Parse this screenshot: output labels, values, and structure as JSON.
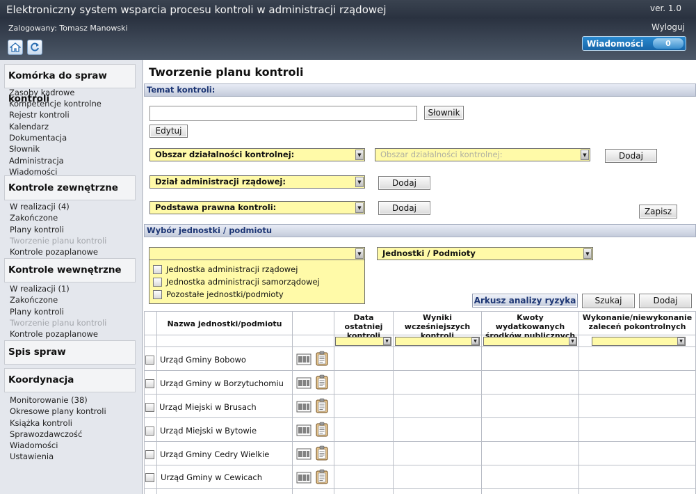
{
  "header": {
    "title": "Elektroniczny system wsparcia procesu kontroli w administracji rządowej",
    "version": "ver. 1.0",
    "user": "Zalogowany: Tomasz Manowski",
    "logout": "Wyloguj",
    "messages_label": "Wiadomości",
    "messages_count": "0"
  },
  "sidebar": {
    "sections": [
      {
        "title": "Komórka do spraw kontroli",
        "items": [
          "Zasoby kadrowe",
          "Kompetencje kontrolne",
          "Rejestr kontroli",
          "Kalendarz",
          "Dokumentacja",
          "Słownik",
          "Administracja",
          "Wiadomości"
        ]
      },
      {
        "title": "Kontrole zewnętrzne",
        "items": [
          "W realizacji (4)",
          "Zakończone",
          "Plany kontroli",
          "Tworzenie planu kontroli",
          "Kontrole pozaplanowe"
        ]
      },
      {
        "title": "Kontrole wewnętrzne",
        "items": [
          "W realizacji (1)",
          "Zakończone",
          "Plany kontroli",
          "Tworzenie planu kontroli",
          "Kontrole pozaplanowe"
        ]
      },
      {
        "title": "Spis spraw",
        "items": []
      },
      {
        "title": "Koordynacja",
        "items": [
          "Monitorowanie (38)",
          "Okresowe plany kontroli",
          "Książka kontroli",
          "Sprawozdawczość",
          "Wiadomości",
          "Ustawienia"
        ]
      }
    ]
  },
  "main": {
    "title": "Tworzenie planu kontroli",
    "section_topic": "Temat kontroli:",
    "slownik_button": "Słownik",
    "edytuj_button": "Edytuj",
    "obszar_select": "Obszar działalności kontrolnej:",
    "obszar_select2": "Obszar działalności kontrolnej:",
    "dzial_select": "Dział administracji rządowej:",
    "podstawa_select": "Podstawa prawna kontroli:",
    "dodaj_label": "Dodaj",
    "zapisz_button": "Zapisz",
    "section_units": "Wybór jednostki / podmiotu",
    "units_select": "",
    "units_select2": "Jednostki / Podmioty",
    "unit_types": [
      "Jednostka administracji rządowej",
      "Jednostka administracji samorządowej",
      "Pozostałe jednostki/podmioty"
    ],
    "arkusz_button": "Arkusz analizy ryzyka",
    "szukaj_button": "Szukaj",
    "dodaj2_button": "Dodaj"
  },
  "table": {
    "headers": [
      "Nazwa jednostki/podmiotu",
      "Data ostatniej kontroli",
      "Wyniki wcześniejszych kontroli",
      "Kwoty wydatkowanych środków publicznych",
      "Wykonanie/niewykonanie zaleceń pokontrolnych"
    ],
    "rows": [
      "Urząd Gminy Bobowo",
      "Urząd Gminy w Borzytuchomiu",
      "Urząd Miejski w Brusach",
      "Urząd Miejski w Bytowie",
      "Urząd Gminy Cedry Wielkie",
      "Urząd Gminy w Cewicach"
    ]
  },
  "colors": {
    "select_bg": "#fffaa8",
    "section_text": "#1d3674",
    "header_bg": "#2a3240"
  }
}
